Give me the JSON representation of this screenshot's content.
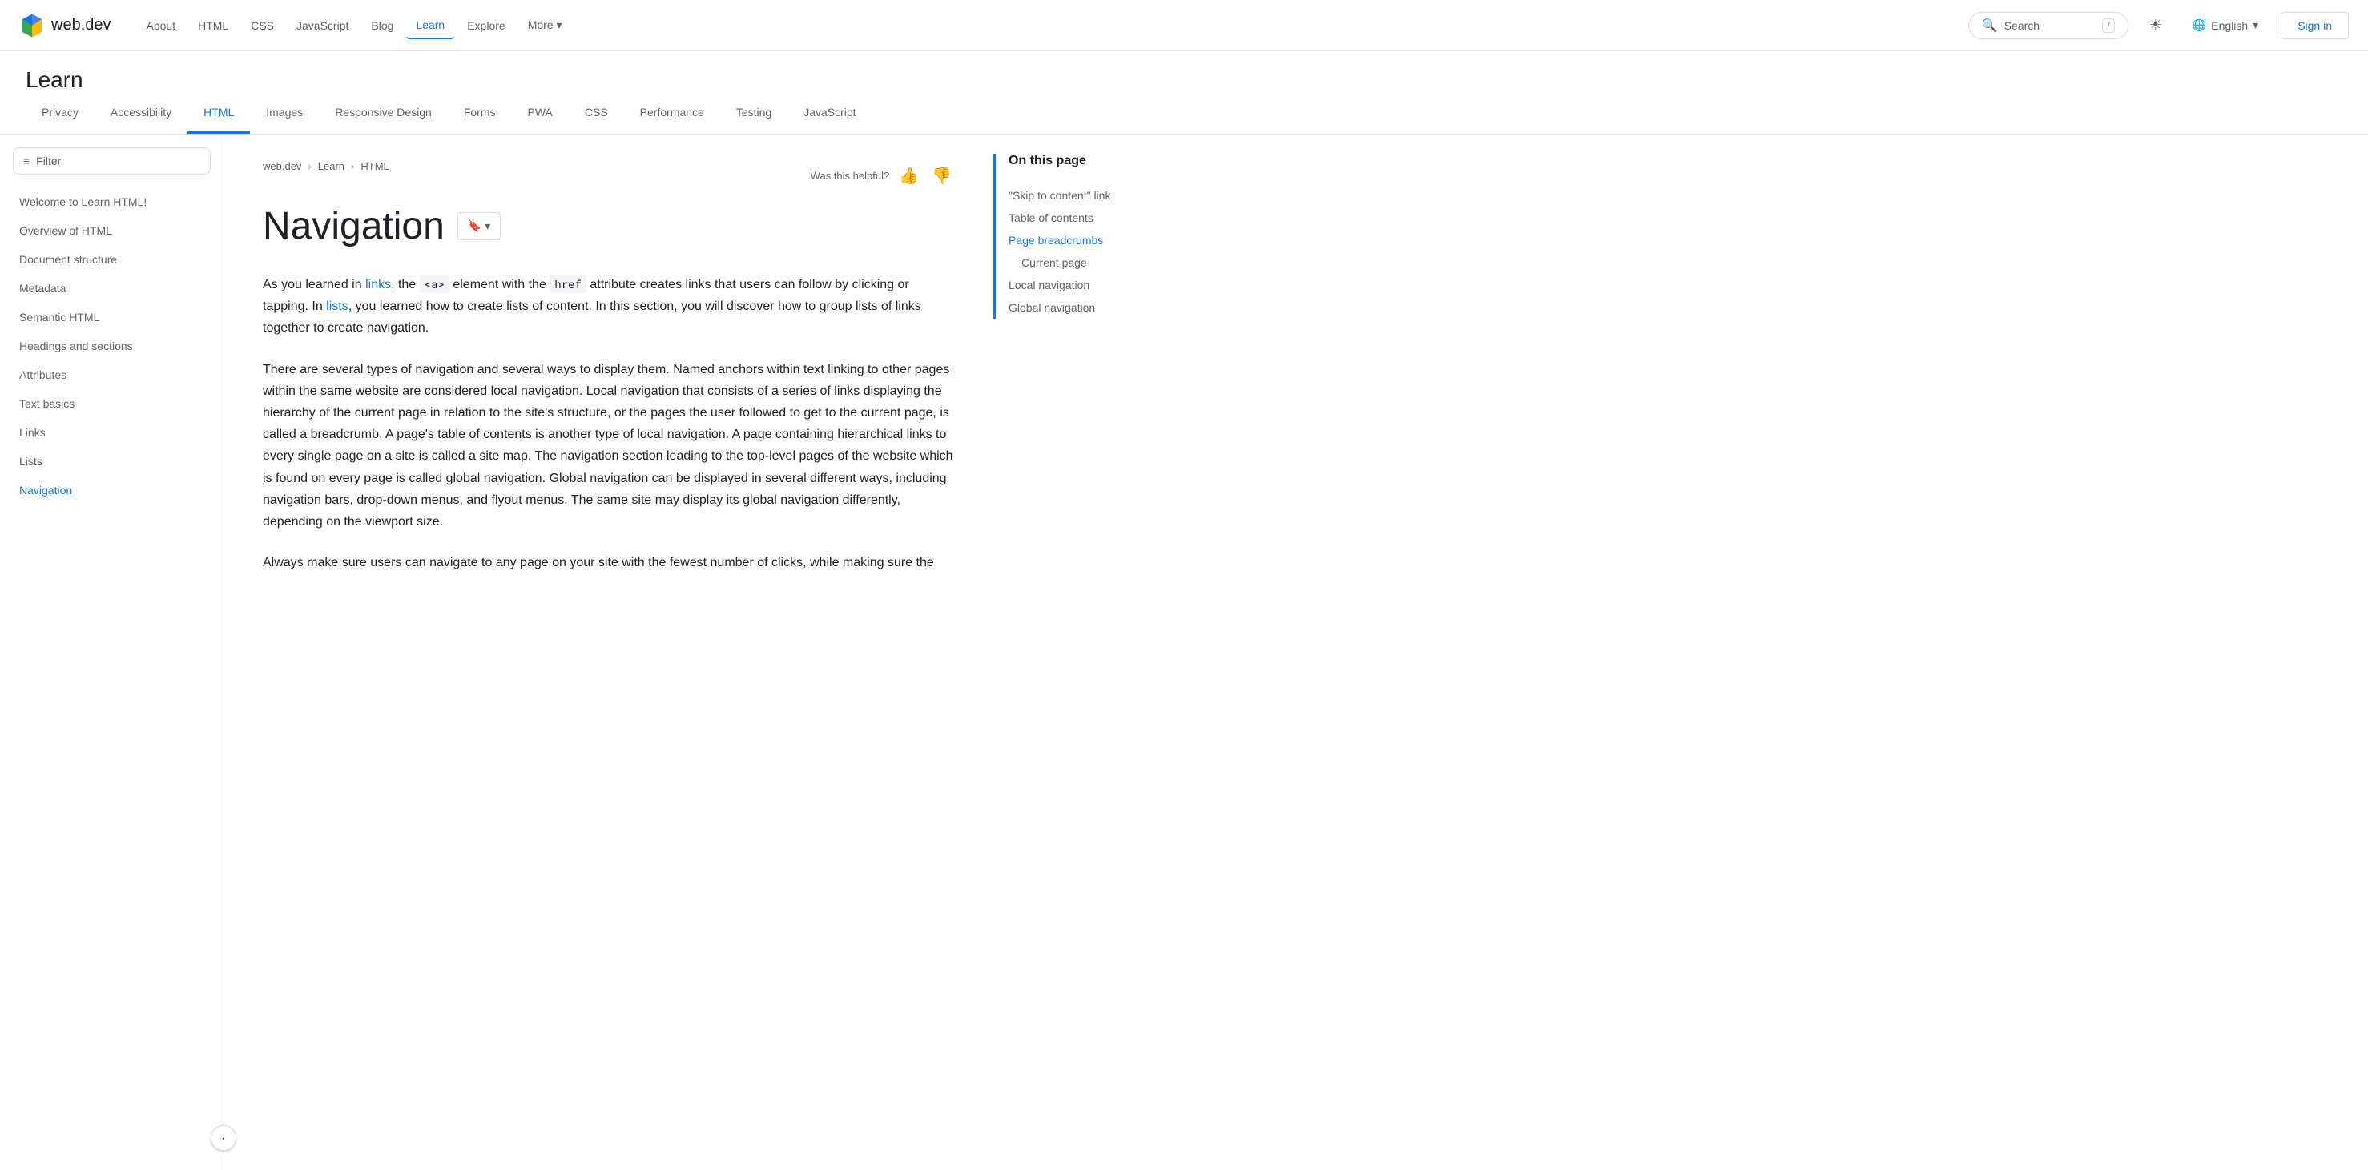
{
  "logo": {
    "text": "web.dev"
  },
  "topnav": {
    "links": [
      {
        "label": "About",
        "active": false
      },
      {
        "label": "HTML",
        "active": false
      },
      {
        "label": "CSS",
        "active": false
      },
      {
        "label": "JavaScript",
        "active": false
      },
      {
        "label": "Blog",
        "active": false
      },
      {
        "label": "Learn",
        "active": true
      },
      {
        "label": "Explore",
        "active": false
      },
      {
        "label": "More ▾",
        "active": false
      }
    ],
    "search_placeholder": "Search",
    "search_shortcut": "/",
    "theme_icon": "☀",
    "language": "English",
    "signin": "Sign in"
  },
  "learn_header": "Learn",
  "category_tabs": [
    {
      "label": "Privacy",
      "active": false
    },
    {
      "label": "Accessibility",
      "active": false
    },
    {
      "label": "HTML",
      "active": true
    },
    {
      "label": "Images",
      "active": false
    },
    {
      "label": "Responsive Design",
      "active": false
    },
    {
      "label": "Forms",
      "active": false
    },
    {
      "label": "PWA",
      "active": false
    },
    {
      "label": "CSS",
      "active": false
    },
    {
      "label": "Performance",
      "active": false
    },
    {
      "label": "Testing",
      "active": false
    },
    {
      "label": "JavaScript",
      "active": false
    }
  ],
  "filter": {
    "placeholder": "Filter",
    "icon": "≡"
  },
  "sidebar_items": [
    {
      "label": "Welcome to Learn HTML!",
      "active": false
    },
    {
      "label": "Overview of HTML",
      "active": false
    },
    {
      "label": "Document structure",
      "active": false
    },
    {
      "label": "Metadata",
      "active": false
    },
    {
      "label": "Semantic HTML",
      "active": false
    },
    {
      "label": "Headings and sections",
      "active": false
    },
    {
      "label": "Attributes",
      "active": false
    },
    {
      "label": "Text basics",
      "active": false
    },
    {
      "label": "Links",
      "active": false
    },
    {
      "label": "Lists",
      "active": false
    },
    {
      "label": "Navigation",
      "active": true
    }
  ],
  "breadcrumb": {
    "items": [
      {
        "label": "web.dev"
      },
      {
        "label": "Learn"
      },
      {
        "label": "HTML"
      }
    ]
  },
  "helpful": {
    "label": "Was this helpful?"
  },
  "page": {
    "title": "Navigation",
    "bookmark_label": "🔖▾",
    "paragraphs": [
      "As you learned in links, the <a> element with the href attribute creates links that users can follow by clicking or tapping. In lists, you learned how to create lists of content. In this section, you will discover how to group lists of links together to create navigation.",
      "There are several types of navigation and several ways to display them. Named anchors within text linking to other pages within the same website are considered local navigation. Local navigation that consists of a series of links displaying the hierarchy of the current page in relation to the site's structure, or the pages the user followed to get to the current page, is called a breadcrumb. A page's table of contents is another type of local navigation. A page containing hierarchical links to every single page on a site is called a site map. The navigation section leading to the top-level pages of the website which is found on every page is called global navigation. Global navigation can be displayed in several different ways, including navigation bars, drop-down menus, and flyout menus. The same site may display its global navigation differently, depending on the viewport size.",
      "Always make sure users can navigate to any page on your site with the fewest number of clicks, while making sure the"
    ],
    "inline_links": [
      {
        "text": "links",
        "href": "#"
      },
      {
        "text": "lists",
        "href": "#"
      }
    ],
    "inline_codes": [
      "<a>",
      "href"
    ]
  },
  "on_this_page": {
    "title": "On this page",
    "items": [
      {
        "label": "\"Skip to content\" link",
        "active": false,
        "sub": false
      },
      {
        "label": "Table of contents",
        "active": false,
        "sub": false
      },
      {
        "label": "Page breadcrumbs",
        "active": true,
        "sub": false
      },
      {
        "label": "Current page",
        "active": false,
        "sub": true
      },
      {
        "label": "Local navigation",
        "active": false,
        "sub": false
      },
      {
        "label": "Global navigation",
        "active": false,
        "sub": false
      }
    ]
  }
}
